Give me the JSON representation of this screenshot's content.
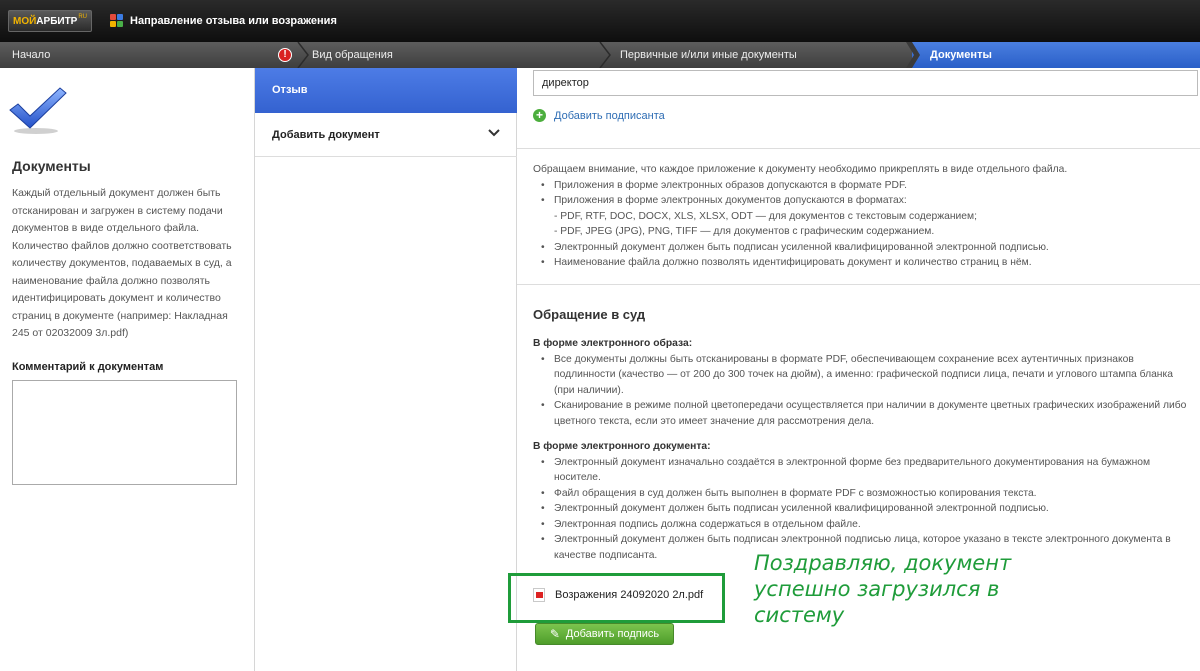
{
  "app": {
    "logo_main": "МОЙ",
    "logo_second": "АРБИТР",
    "logo_suffix": "RU",
    "title": "Направление отзыва или возражения"
  },
  "stepper": {
    "steps": [
      "Начало",
      "Вид обращения",
      "Первичные и/или иные документы",
      "Документы"
    ],
    "active_index": 3,
    "error_mark": "!"
  },
  "left": {
    "title": "Документы",
    "description": "Каждый отдельный документ должен быть отсканирован и загружен в систему подачи документов в виде отдельного файла. Количество файлов должно соответствовать количеству документов, подаваемых в суд, а наименование файла должно позволять идентифицировать документ и количество страниц в документе (например: Накладная 245 от 02032009 3л.pdf)",
    "comment_label": "Комментарий к документам",
    "comment_value": ""
  },
  "nav": {
    "active_label": "Отзыв",
    "add_document_label": "Добавить документ"
  },
  "content": {
    "signer_value": "директор",
    "add_signer_label": "Добавить подписанта",
    "notice_intro": "Обращаем внимание, что каждое приложение к документу необходимо прикреплять в виде отдельного файла.",
    "notice_items": [
      "Приложения в форме электронных образов допускаются в формате PDF.",
      "Приложения в форме электронных документов допускаются в форматах:",
      "Электронный документ должен быть подписан усиленной квалифицированной электронной подписью.",
      "Наименование файла должно позволять идентифицировать документ и количество страниц в нём."
    ],
    "notice_sub": [
      "- PDF, RTF, DOC, DOCX, XLS, XLSX, ODT — для документов с текстовым содержанием;",
      "- PDF, JPEG (JPG), PNG, TIFF — для документов с графическим содержанием."
    ],
    "court_title": "Обращение в суд",
    "image_form_title": "В форме электронного образа:",
    "image_form_items": [
      "Все документы должны быть отсканированы в формате PDF, обеспечивающем сохранение всех аутентичных признаков подлинности (качество — от 200 до 300 точек на дюйм), а именно: графической подписи лица, печати и углового штампа бланка (при наличии).",
      "Сканирование в режиме полной цветопередачи осуществляется при наличии в документе цветных графических изображений либо цветного текста, если это имеет значение для рассмотрения дела."
    ],
    "doc_form_title": "В форме электронного документа:",
    "doc_form_items": [
      "Электронный документ изначально создаётся в электронной форме без предварительного документирования на бумажном носителе.",
      "Файл обращения в суд должен быть выполнен в формате PDF с возможностью копирования текста.",
      "Электронный документ должен быть подписан усиленной квалифицированной электронной подписью.",
      "Электронная подпись должна содержаться в отдельном файле.",
      "Электронный документ должен быть подписан электронной подписью лица, которое указано в тексте электронного документа в качестве подписанта."
    ],
    "file_name": "Возражения 24092020 2л.pdf",
    "add_signature_label": "Добавить подпись"
  },
  "annotation": "Поздравляю, документ успешно загрузился в систему",
  "colors": {
    "accent_blue": "#3462d0",
    "success_green": "#1f9c3a",
    "error_red": "#d92121"
  }
}
